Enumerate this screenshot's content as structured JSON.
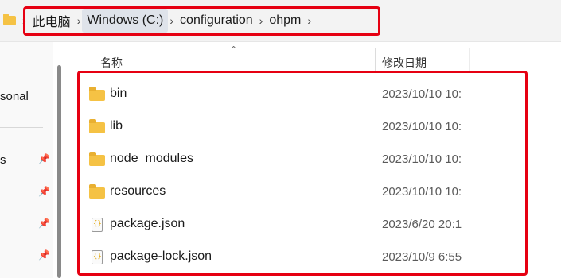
{
  "breadcrumb": {
    "items": [
      "此电脑",
      "Windows (C:)",
      "configuration",
      "ohpm"
    ],
    "separator": "›"
  },
  "nav": {
    "items": [
      "sonal",
      "s"
    ]
  },
  "columns": {
    "name": "名称",
    "date": "修改日期"
  },
  "files": [
    {
      "name": "bin",
      "type": "folder",
      "date": "2023/10/10 10:"
    },
    {
      "name": "lib",
      "type": "folder",
      "date": "2023/10/10 10:"
    },
    {
      "name": "node_modules",
      "type": "folder",
      "date": "2023/10/10 10:"
    },
    {
      "name": "resources",
      "type": "folder",
      "date": "2023/10/10 10:"
    },
    {
      "name": "package.json",
      "type": "json-file",
      "date": "2023/6/20 20:1"
    },
    {
      "name": "package-lock.json",
      "type": "json-file",
      "date": "2023/10/9 6:55"
    }
  ],
  "colors": {
    "highlight": "#e60012",
    "folder": "#f5c244"
  }
}
